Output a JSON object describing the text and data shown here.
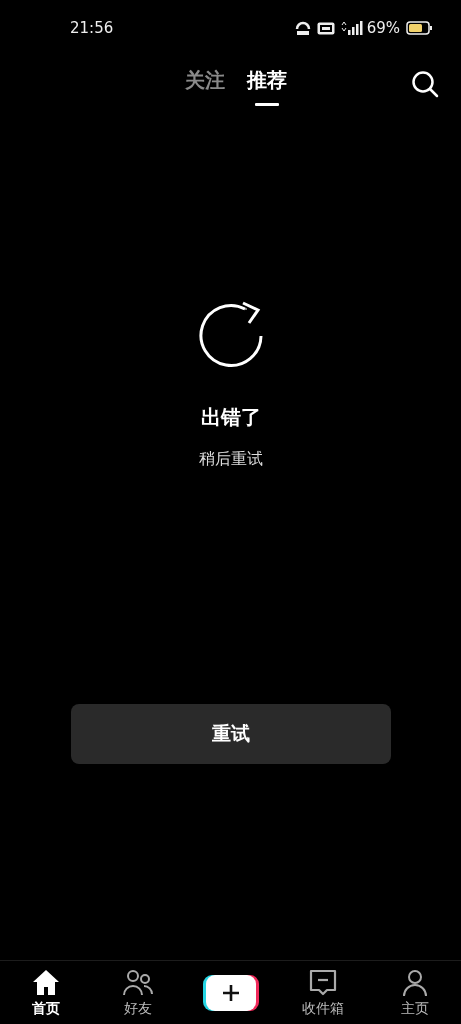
{
  "status_bar": {
    "time": "21:56",
    "battery": "69%"
  },
  "top_tabs": [
    {
      "label": "关注",
      "selected": false
    },
    {
      "label": "推荐",
      "selected": true
    }
  ],
  "error": {
    "title": "出错了",
    "message": "稍后重试",
    "button": "重试"
  },
  "bottom_nav": [
    {
      "kind": "home",
      "label": "首页",
      "selected": true
    },
    {
      "kind": "friends",
      "label": "好友",
      "selected": false
    },
    {
      "kind": "create"
    },
    {
      "kind": "inbox",
      "label": "收件箱",
      "selected": false
    },
    {
      "kind": "profile",
      "label": "主页",
      "selected": false
    }
  ]
}
